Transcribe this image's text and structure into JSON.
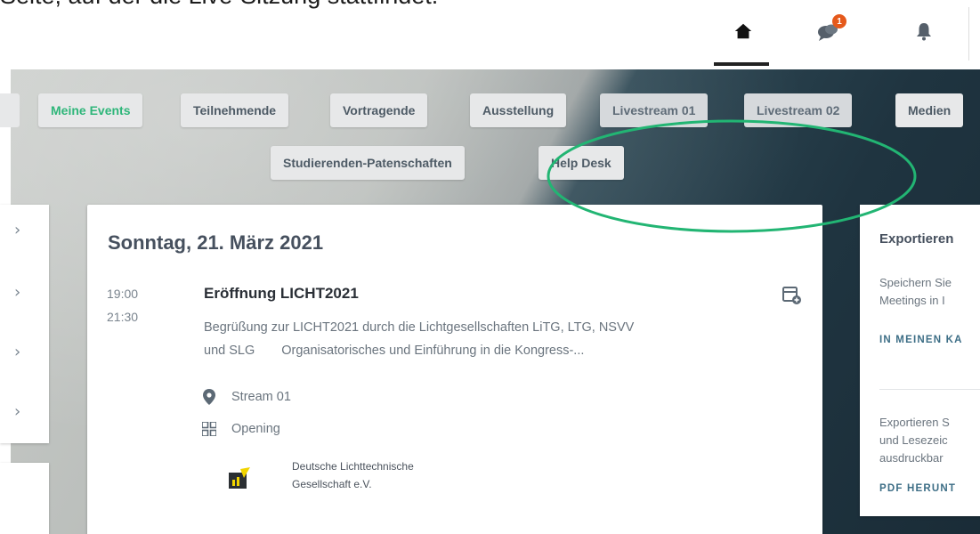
{
  "caption": "Seite, auf der die Live-Sitzung stattfindet.",
  "toolbar": {
    "home_icon": "home-icon",
    "chat_icon": "chat-icon",
    "chat_badge": "1",
    "bell_icon": "bell-icon"
  },
  "nav": {
    "items": [
      {
        "label": "Meine Events",
        "active": true
      },
      {
        "label": "Teilnehmende"
      },
      {
        "label": "Vortragende"
      },
      {
        "label": "Ausstellung"
      },
      {
        "label": "Livestream 01"
      },
      {
        "label": "Livestream 02"
      },
      {
        "label": "Medien"
      },
      {
        "label": "Studierenden-Patenschaften"
      },
      {
        "label": "Help Desk"
      }
    ]
  },
  "event_day": {
    "date_heading": "Sonntag, 21. März 2021",
    "event": {
      "start_time": "19:00",
      "end_time": "21:30",
      "title": "Eröffnung LICHT2021",
      "description_line1": "Begrüßung zur LICHT2021 durch die Lichtgesellschaften LiTG, LTG, NSVV",
      "description_line2a": "und SLG",
      "description_line2b": "Organisatorisches und Einführung in die Kongress-...",
      "location": "Stream 01",
      "category": "Opening",
      "organizer_line1": "Deutsche Lichttechnische",
      "organizer_line2": "Gesellschaft e.V."
    }
  },
  "export_panel": {
    "title": "Exportieren",
    "text1_line1": "Speichern Sie",
    "text1_line2": "Meetings in I",
    "link1": "IN MEINEN KA",
    "text2_line1": "Exportieren S",
    "text2_line2": "und Lesezeic",
    "text2_line3": "ausdruckbar",
    "link2": "PDF HERUNT"
  },
  "colors": {
    "active_nav": "#2fb67a",
    "annotation": "#22b573",
    "badge": "#e5591b",
    "link": "#3d6e86"
  }
}
